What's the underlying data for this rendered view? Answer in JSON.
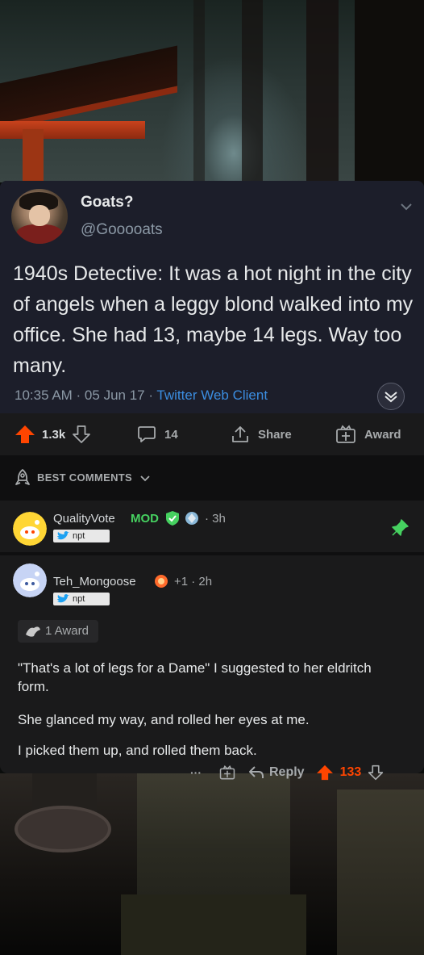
{
  "tweet": {
    "display_name": "Goats?",
    "handle": "@Gooooats",
    "text": "1940s Detective: It was a hot night in the city of angels when a leggy blond walked into my office. She had 13, maybe 14 legs. Way too many.",
    "timestamp": "10:35 AM · 05 Jun 17 · ",
    "client": "Twitter Web Client"
  },
  "post_actions": {
    "upvotes": "1.3k",
    "comments": "14",
    "share_label": "Share",
    "award_label": "Award",
    "upvote_color": "#ff4500"
  },
  "sort": {
    "label": "BEST COMMENTS"
  },
  "mod_comment": {
    "username": "QualityVote",
    "mod_badge": "MOD",
    "time": "· 3h",
    "flair": "npt",
    "mod_color": "#46d160"
  },
  "comment": {
    "username": "Teh_Mongoose",
    "score_extra": "+1 · 2h",
    "flair": "npt",
    "award_count": "1 Award",
    "paragraphs": [
      "\"That's a lot of legs for a Dame\" I suggested to her eldritch form.",
      "She glanced my way, and rolled her eyes at me.",
      "I picked them up, and rolled them back."
    ],
    "more": "···",
    "reply_label": "Reply",
    "score": "133"
  }
}
